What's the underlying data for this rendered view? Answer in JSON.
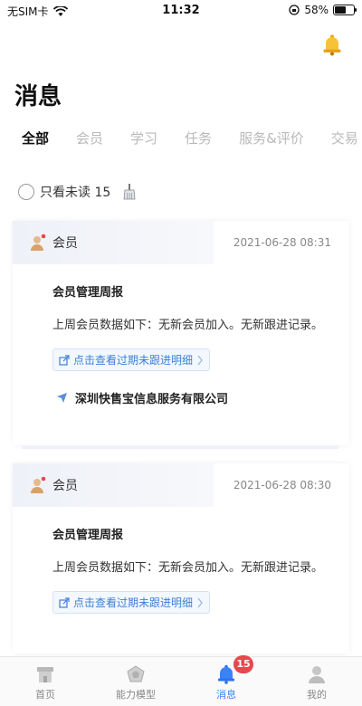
{
  "status_bar": {
    "carrier": "无SIM卡",
    "time": "11:32",
    "battery_percent": "58%",
    "battery_level": 0.58
  },
  "page": {
    "title": "消息"
  },
  "tabs": [
    {
      "label": "全部",
      "active": true
    },
    {
      "label": "会员",
      "active": false
    },
    {
      "label": "学习",
      "active": false
    },
    {
      "label": "任务",
      "active": false
    },
    {
      "label": "服务&评价",
      "active": false
    },
    {
      "label": "交易",
      "active": false
    }
  ],
  "filter": {
    "label": "只看未读 15"
  },
  "messages": [
    {
      "category": "会员",
      "time": "2021-06-28 08:31",
      "title": "会员管理周报",
      "text": "上周会员数据如下：无新会员加入。无新跟进记录。",
      "link": "点击查看过期未跟进明细",
      "company": "深圳快售宝信息服务有限公司"
    },
    {
      "category": "会员",
      "time": "2021-06-28 08:30",
      "title": "会员管理周报",
      "text": "上周会员数据如下：无新会员加入。无新跟进记录。",
      "link": "点击查看过期未跟进明细"
    }
  ],
  "bottom_nav": {
    "items": [
      {
        "label": "首页",
        "icon": "home-icon"
      },
      {
        "label": "能力模型",
        "icon": "ability-icon"
      },
      {
        "label": "消息",
        "icon": "bell-icon",
        "active": true
      },
      {
        "label": "我的",
        "icon": "profile-icon"
      }
    ],
    "badge": "15"
  },
  "colors": {
    "accent": "#3b82f6",
    "badge": "#e8474e",
    "bell": "#f2b01e"
  }
}
